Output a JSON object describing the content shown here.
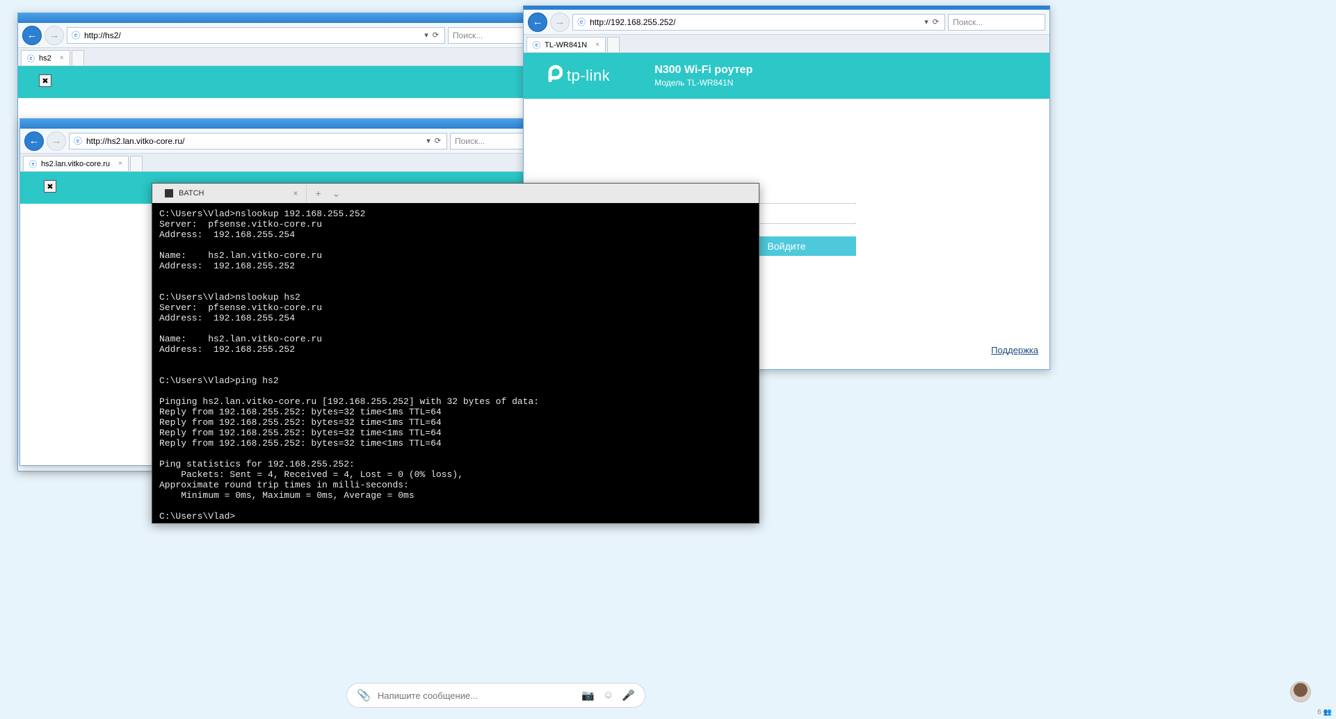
{
  "w1": {
    "url": "http://hs2/",
    "search_placeholder": "Поиск...",
    "tab_title": "hs2",
    "broken": "✖"
  },
  "w2": {
    "url": "http://hs2.lan.vitko-core.ru/",
    "search_placeholder": "Поиск...",
    "tab_title": "hs2.lan.vitko-core.ru",
    "broken": "✖"
  },
  "w3": {
    "url": "http://192.168.255.252/",
    "search_placeholder": "Поиск...",
    "tab_title": "TL-WR841N",
    "logo_text": "tp-link",
    "header_title": "N300 Wi-Fi роутер",
    "header_model": "Модель TL-WR841N",
    "login_button": "Войдите",
    "support": "Поддержка"
  },
  "term": {
    "tab_label": "BATCH",
    "output": "C:\\Users\\Vlad>nslookup 192.168.255.252\nServer:  pfsense.vitko-core.ru\nAddress:  192.168.255.254\n\nName:    hs2.lan.vitko-core.ru\nAddress:  192.168.255.252\n\n\nC:\\Users\\Vlad>nslookup hs2\nServer:  pfsense.vitko-core.ru\nAddress:  192.168.255.254\n\nName:    hs2.lan.vitko-core.ru\nAddress:  192.168.255.252\n\n\nC:\\Users\\Vlad>ping hs2\n\nPinging hs2.lan.vitko-core.ru [192.168.255.252] with 32 bytes of data:\nReply from 192.168.255.252: bytes=32 time<1ms TTL=64\nReply from 192.168.255.252: bytes=32 time<1ms TTL=64\nReply from 192.168.255.252: bytes=32 time<1ms TTL=64\nReply from 192.168.255.252: bytes=32 time<1ms TTL=64\n\nPing statistics for 192.168.255.252:\n    Packets: Sent = 4, Received = 4, Lost = 0 (0% loss),\nApproximate round trip times in milli-seconds:\n    Minimum = 0ms, Maximum = 0ms, Average = 0ms\n\nC:\\Users\\Vlad>"
  },
  "msgbar": {
    "placeholder": "Напишите сообщение..."
  },
  "notif": "6"
}
